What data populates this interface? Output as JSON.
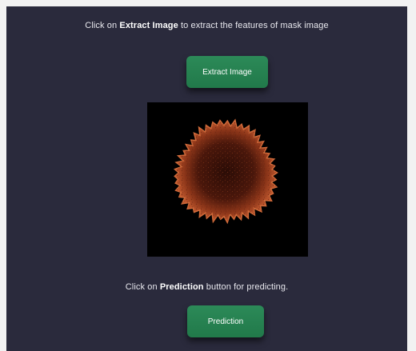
{
  "instructions": {
    "extract_prefix": "Click on ",
    "extract_bold": "Extract Image",
    "extract_suffix": " to extract the features of mask image",
    "predict_prefix": "Click on ",
    "predict_bold": "Prediction",
    "predict_suffix": " button for predicting."
  },
  "buttons": {
    "extract_label": "Extract Image",
    "predict_label": "Prediction"
  },
  "colors": {
    "background": "#2a2a3c",
    "button": "#21794a",
    "cell": "#b9532e"
  }
}
